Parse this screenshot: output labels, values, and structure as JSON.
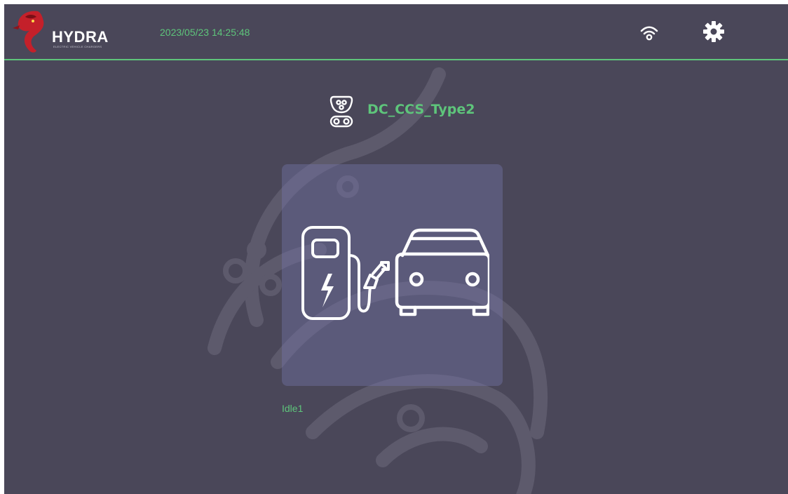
{
  "header": {
    "logo_word": "HYDRA",
    "logo_tagline": "ELECTRIC VEHICLE CHARGERS",
    "datetime": "2023/05/23 14:25:48"
  },
  "connector": {
    "name": "DC_CCS_Type2",
    "status": "Idle1"
  },
  "colors": {
    "background": "#4a4759",
    "accent_green": "#5ec57b",
    "card": "rgba(120,120,175,0.38)",
    "icon_white": "#ffffff"
  },
  "icons": {
    "logo": "dragon-logo-icon",
    "wifi": "wifi-icon",
    "settings": "gear-icon",
    "connector": "ccs2-connector-icon",
    "charger": "charging-station-icon",
    "car": "car-icon"
  }
}
